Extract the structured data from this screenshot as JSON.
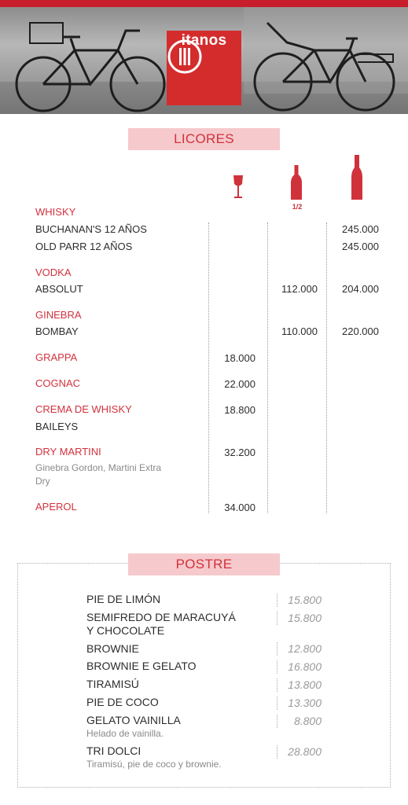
{
  "brand": {
    "name": "itanos",
    "accent_color": "#d42c2c",
    "heading_bg": "#f6c9cc"
  },
  "licores": {
    "title": "LICORES",
    "columns": [
      {
        "icon": "wine-glass-icon",
        "label": ""
      },
      {
        "icon": "half-bottle-icon",
        "label": "1/2"
      },
      {
        "icon": "bottle-icon",
        "label": ""
      }
    ],
    "groups": [
      {
        "category": "WHISKY",
        "items": [
          {
            "name": "BUCHANAN'S 12 AÑOS",
            "glass": "",
            "half": "",
            "bottle": "245.000"
          },
          {
            "name": "OLD PARR 12 AÑOS",
            "glass": "",
            "half": "",
            "bottle": "245.000"
          }
        ]
      },
      {
        "category": "VODKA",
        "items": [
          {
            "name": "ABSOLUT",
            "glass": "",
            "half": "112.000",
            "bottle": "204.000"
          }
        ]
      },
      {
        "category": "GINEBRA",
        "items": [
          {
            "name": "BOMBAY",
            "glass": "",
            "half": "110.000",
            "bottle": "220.000"
          }
        ]
      },
      {
        "category": "GRAPPA",
        "glass": "18.000"
      },
      {
        "category": "COGNAC",
        "glass": "22.000"
      },
      {
        "category": "CREMA DE WHISKY",
        "glass": "18.800",
        "items": [
          {
            "name": "BAILEYS"
          }
        ]
      },
      {
        "category": "DRY MARTINI",
        "glass": "32.200",
        "description": "Ginebra Gordon, Martini Extra Dry"
      },
      {
        "category": "APEROL",
        "glass": "34.000"
      }
    ]
  },
  "postre": {
    "title": "POSTRE",
    "items": [
      {
        "name": "PIE DE LIMÓN",
        "price": "15.800"
      },
      {
        "name": "SEMIFREDO DE MARACUYÁ",
        "name_line2": "Y CHOCOLATE",
        "price": "15.800"
      },
      {
        "name": "BROWNIE",
        "price": "12.800"
      },
      {
        "name": "BROWNIE E GELATO",
        "price": "16.800"
      },
      {
        "name": "TIRAMISÚ",
        "price": "13.800"
      },
      {
        "name": "PIE DE COCO",
        "price": "13.300"
      },
      {
        "name": "GELATO VAINILLA",
        "price": "8.800",
        "description": "Helado de vainilla."
      },
      {
        "name": "TRI DOLCI",
        "price": "28.800",
        "description": "Tiramisú, pie de coco y brownie."
      }
    ]
  }
}
